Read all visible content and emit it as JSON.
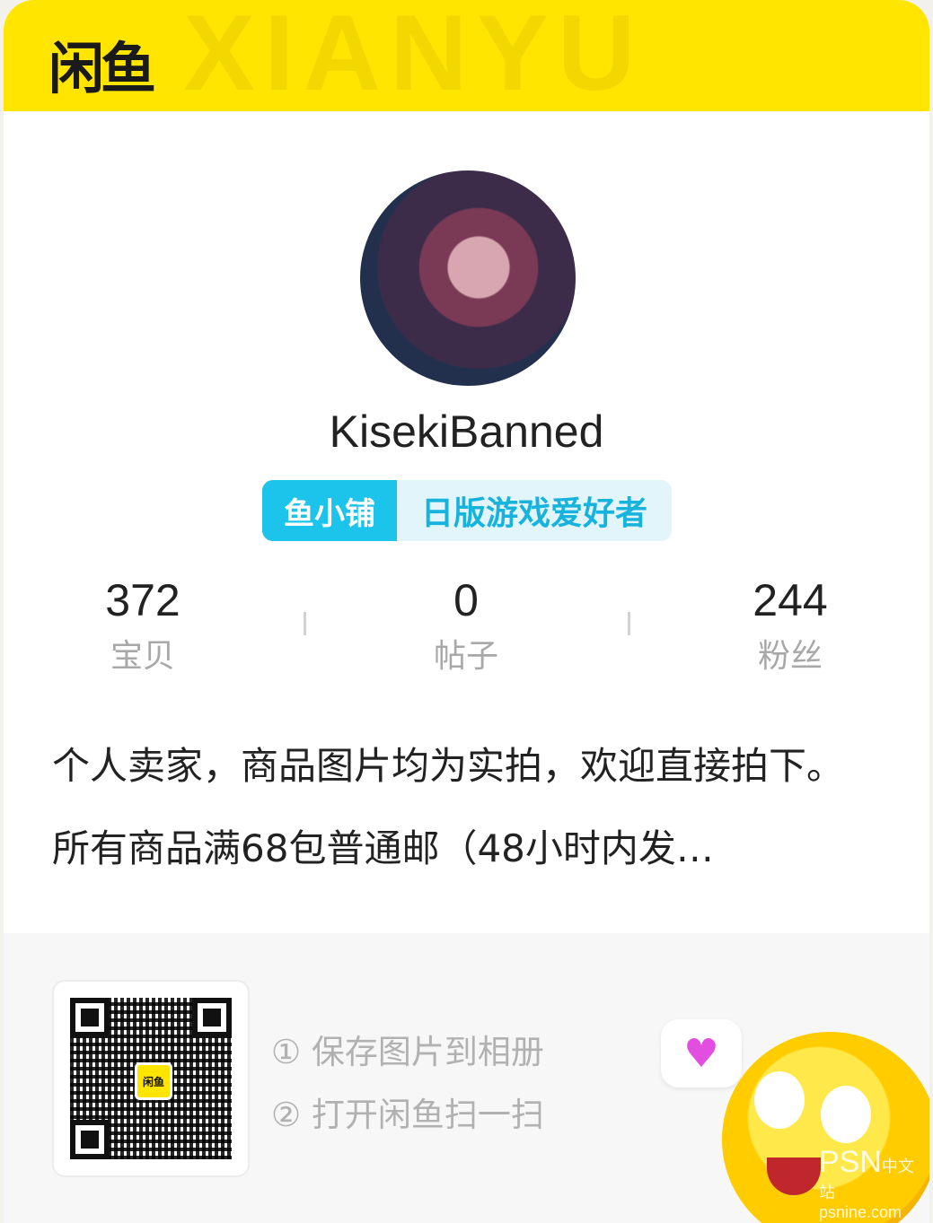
{
  "header": {
    "logo_text": "闲鱼",
    "watermark_text": "XIANYU",
    "background_color": "#ffe500"
  },
  "profile": {
    "avatar_alt": "user-avatar",
    "nickname": "KisekiBanned",
    "tag_badge": "鱼小铺",
    "tag_text": "日版游戏爱好者"
  },
  "stats": [
    {
      "value": "372",
      "label": "宝贝"
    },
    {
      "value": "0",
      "label": "帖子"
    },
    {
      "value": "244",
      "label": "粉丝"
    }
  ],
  "bio": "个人卖家，商品图片均为实拍，欢迎直接拍下。所有商品满68包普通邮（48小时内发…",
  "share": {
    "qr_logo": "闲鱼",
    "step1": "① 保存图片到相册",
    "step2": "② 打开闲鱼扫一扫",
    "bubble_icon": "♥"
  },
  "watermark": {
    "brand": "PSN",
    "brand_cn": "中文站",
    "domain": "psnine.com"
  }
}
